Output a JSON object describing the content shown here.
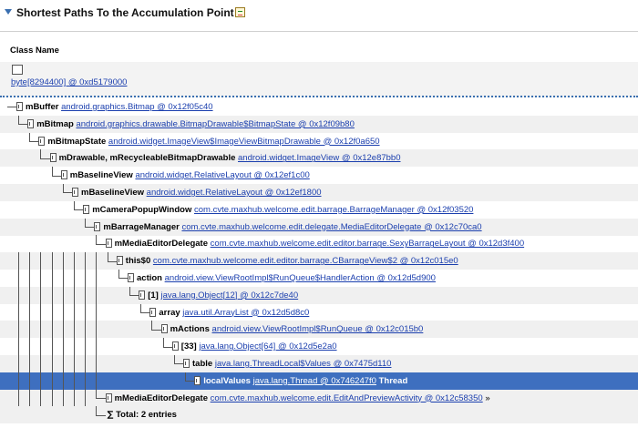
{
  "header": {
    "title": "Shortest Paths To the Accumulation Point"
  },
  "table": {
    "column": "Class Name",
    "root": "byte[8294400] @ 0xd5179000",
    "rows": [
      {
        "field": "mBuffer",
        "link": "android.graphics.Bitmap @ 0x12f05c40"
      },
      {
        "field": "mBitmap",
        "link": "android.graphics.drawable.BitmapDrawable$BitmapState @ 0x12f09b80"
      },
      {
        "field": "mBitmapState",
        "link": "android.widget.ImageView$ImageViewBitmapDrawable @ 0x12f0a650"
      },
      {
        "field": "mDrawable, mRecycleableBitmapDrawable",
        "link": "android.widget.ImageView @ 0x12e87bb0"
      },
      {
        "field": "mBaselineView",
        "link": "android.widget.RelativeLayout @ 0x12ef1c00"
      },
      {
        "field": "mBaselineView",
        "link": "android.widget.RelativeLayout @ 0x12ef1800"
      },
      {
        "field": "mCameraPopupWindow",
        "link": "com.cvte.maxhub.welcome.edit.barrage.BarrageManager @ 0x12f03520"
      },
      {
        "field": "mBarrageManager",
        "link": "com.cvte.maxhub.welcome.edit.delegate.MediaEditorDelegate @ 0x12c70ca0"
      },
      {
        "field": "mMediaEditorDelegate",
        "link": "com.cvte.maxhub.welcome.edit.editor.barrage.SexyBarrageLayout @ 0x12d3f400"
      },
      {
        "field": "this$0",
        "link": "com.cvte.maxhub.welcome.edit.editor.barrage.CBarrageView$2 @ 0x12c015e0"
      },
      {
        "field": "action",
        "link": "android.view.ViewRootImpl$RunQueue$HandlerAction @ 0x12d5d900"
      },
      {
        "field": "[1]",
        "link": "java.lang.Object[12] @ 0x12c7de40"
      },
      {
        "field": "array",
        "link": "java.util.ArrayList @ 0x12d5d8c0"
      },
      {
        "field": "mActions",
        "link": "android.view.ViewRootImpl$RunQueue @ 0x12c015b0"
      },
      {
        "field": "[33]",
        "link": "java.lang.Object[64] @ 0x12d5e2a0"
      },
      {
        "field": "table",
        "link": "java.lang.ThreadLocal$Values @ 0x7475d110"
      },
      {
        "field": "localValues",
        "link": "java.lang.Thread @ 0x746247f0",
        "suffix": "Thread"
      },
      {
        "field": "mMediaEditorDelegate",
        "link": "com.cvte.maxhub.welcome.edit.EditAndPreviewActivity @ 0x12c58350",
        "suffix": "»"
      }
    ],
    "total": "Total: 2 entries",
    "sigma": "∑"
  }
}
